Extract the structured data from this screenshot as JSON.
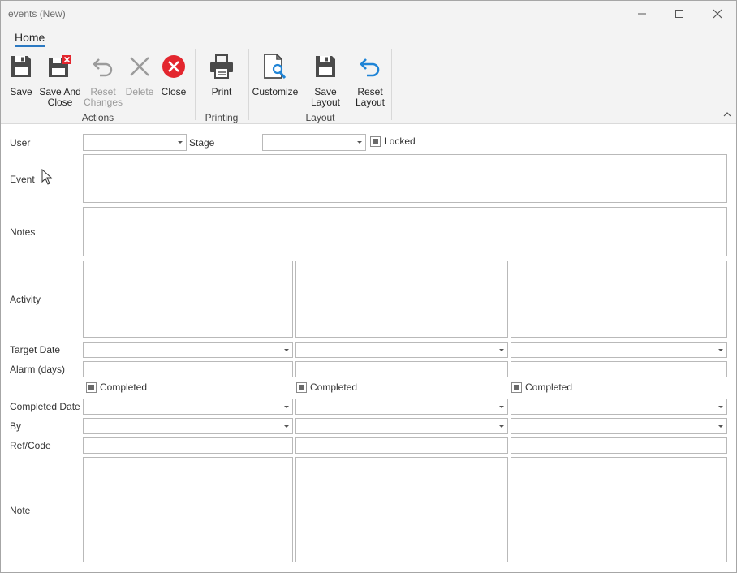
{
  "window": {
    "title": "events (New)"
  },
  "ribbon": {
    "tab": "Home",
    "buttons": {
      "save": "Save",
      "save_close": "Save And\nClose",
      "reset_changes": "Reset\nChanges",
      "delete": "Delete",
      "close": "Close",
      "print": "Print",
      "customize": "Customize",
      "save_layout": "Save Layout",
      "reset_layout": "Reset\nLayout"
    },
    "groups": {
      "actions": "Actions",
      "printing": "Printing",
      "layout": "Layout"
    }
  },
  "form": {
    "labels": {
      "user": "User",
      "stage": "Stage",
      "locked": "Locked",
      "event": "Event",
      "notes": "Notes",
      "activity": "Activity",
      "target_date": "Target Date",
      "alarm_days": "Alarm (days)",
      "completed": "Completed",
      "completed_date": "Completed Date",
      "by": "By",
      "ref_code": "Ref/Code",
      "note": "Note"
    }
  },
  "colors": {
    "accent": "#2b79c2",
    "close_red": "#e3262e",
    "reset_blue": "#1f84d6"
  }
}
